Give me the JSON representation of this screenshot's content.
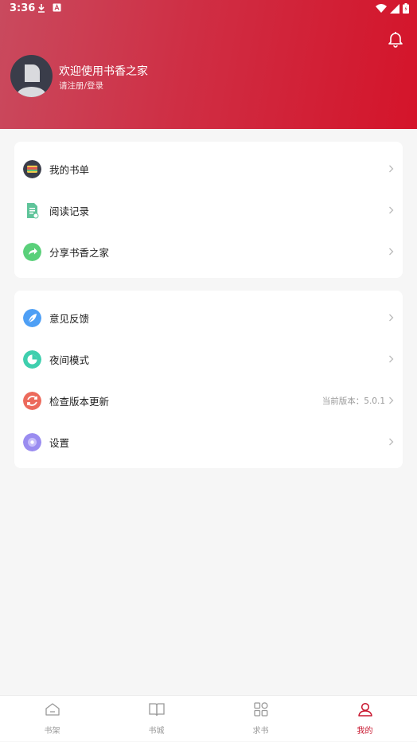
{
  "status_bar": {
    "time": "3:36",
    "left_icons": [
      "download-icon",
      "a-icon"
    ],
    "right_icons": [
      "wifi-icon",
      "signal-icon",
      "battery-icon"
    ]
  },
  "profile": {
    "welcome": "欢迎使用书香之家",
    "login_prompt": "请注册/登录"
  },
  "menu_group_1": [
    {
      "label": "我的书单",
      "icon": "book-list-icon",
      "color": "#3a3d4a"
    },
    {
      "label": "阅读记录",
      "icon": "reading-record-icon",
      "color": "#5fc49a"
    },
    {
      "label": "分享书香之家",
      "icon": "share-icon",
      "color": "#5ad07a"
    }
  ],
  "menu_group_2": [
    {
      "label": "意见反馈",
      "icon": "feedback-icon",
      "color": "#4e9ff5"
    },
    {
      "label": "夜间模式",
      "icon": "night-mode-icon",
      "color": "#3fcfae"
    },
    {
      "label": "检查版本更新",
      "icon": "update-icon",
      "color": "#ec6a5c",
      "extra": "当前版本：5.0.1"
    },
    {
      "label": "设置",
      "icon": "settings-icon",
      "color": "#9a8cf0"
    }
  ],
  "tabs": [
    {
      "label": "书架",
      "icon": "bookshelf-icon",
      "active": false
    },
    {
      "label": "书城",
      "icon": "bookstore-icon",
      "active": false
    },
    {
      "label": "求书",
      "icon": "request-book-icon",
      "active": false
    },
    {
      "label": "我的",
      "icon": "profile-icon",
      "active": true
    }
  ],
  "colors": {
    "accent": "#c8162e",
    "header_start": "#c94a5e",
    "header_end": "#d4142a"
  }
}
